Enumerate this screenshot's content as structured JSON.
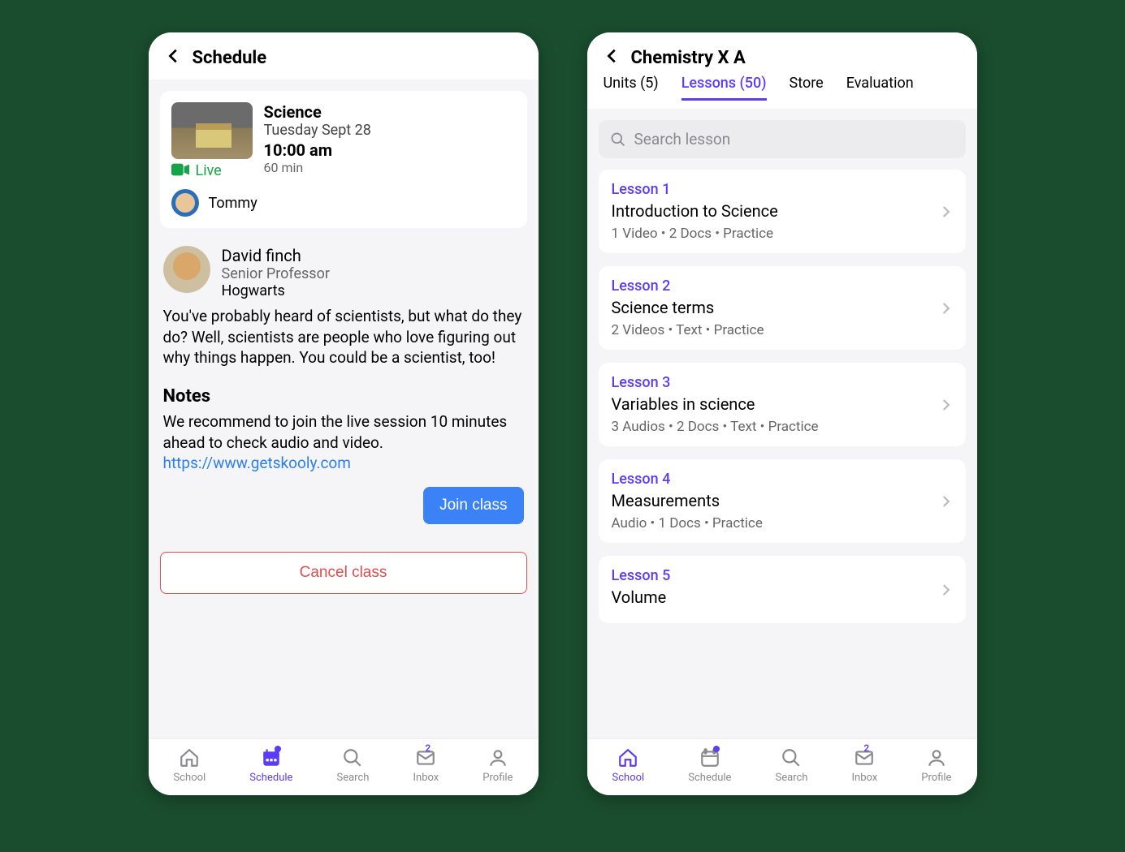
{
  "colors": {
    "accent": "#5b3df5",
    "primary_btn": "#3b82f6",
    "danger": "#e24b4b",
    "live": "#17a34a"
  },
  "left": {
    "header_title": "Schedule",
    "class": {
      "subject": "Science",
      "date": "Tuesday Sept 28",
      "time": "10:00 am",
      "duration": "60 min",
      "live_label": "Live",
      "student_name": "Tommy"
    },
    "professor": {
      "name": "David finch",
      "title": "Senior Professor",
      "org": "Hogwarts"
    },
    "description": "You've probably heard of scientists, but what do they do? Well, scientists are people who love figuring out why things happen. You could be a scientist, too!",
    "notes_heading": "Notes",
    "notes_body": "We recommend to join the live session 10 minutes ahead to check audio and video.",
    "notes_link": "https://www.getskooly.com",
    "join_label": "Join class",
    "cancel_label": "Cancel class"
  },
  "right": {
    "header_title": "Chemistry X A",
    "tabs": {
      "units": "Units (5)",
      "lessons": "Lessons (50)",
      "store": "Store",
      "evaluation": "Evaluation"
    },
    "search_placeholder": "Search lesson",
    "lessons": [
      {
        "label": "Lesson 1",
        "name": "Introduction to Science",
        "meta": "1 Video  •  2 Docs  •  Practice"
      },
      {
        "label": "Lesson 2",
        "name": "Science terms",
        "meta": "2 Videos  •  Text  •  Practice"
      },
      {
        "label": "Lesson 3",
        "name": "Variables in science",
        "meta": "3 Audios  •  2 Docs  •  Text  •  Practice"
      },
      {
        "label": "Lesson 4",
        "name": "Measurements",
        "meta": "Audio  •  1 Docs  •  Practice"
      },
      {
        "label": "Lesson 5",
        "name": "Volume",
        "meta": ""
      }
    ]
  },
  "nav": {
    "school": "School",
    "schedule": "Schedule",
    "search": "Search",
    "inbox": "Inbox",
    "profile": "Profile",
    "inbox_badge": "2"
  }
}
